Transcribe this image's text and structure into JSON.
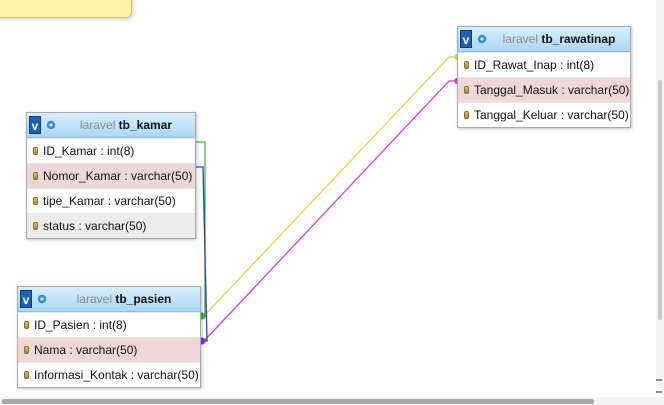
{
  "colors": {
    "link_yellow": "#d4de3a",
    "link_magenta": "#d63cd6",
    "link_green": "#3fb43f",
    "link_blue": "#2a3fb4",
    "header_blue": "#a9d7f7",
    "highlight_row": "#efd7d7"
  },
  "icons": {
    "toggle": "v-toggle-icon",
    "options": "gear-icon",
    "column": "column-key-icon"
  },
  "tables": {
    "tb_rawatinap": {
      "db": "laravel",
      "name": "tb_rawatinap",
      "toggle_label": "v",
      "columns": [
        "ID_Rawat_Inap : int(8)",
        "Tanggal_Masuk : varchar(50)",
        "Tanggal_Keluar : varchar(50)"
      ]
    },
    "tb_kamar": {
      "db": "laravel",
      "name": "tb_kamar",
      "toggle_label": "v",
      "columns": [
        "ID_Kamar : int(8)",
        "Nomor_Kamar : varchar(50)",
        "tipe_Kamar : varchar(50)",
        "status : varchar(50)"
      ]
    },
    "tb_pasien": {
      "db": "laravel",
      "name": "tb_pasien",
      "toggle_label": "v",
      "columns": [
        "ID_Pasien : int(8)",
        "Nama : varchar(50)",
        "Informasi_Kontak : varchar(50)"
      ]
    }
  }
}
